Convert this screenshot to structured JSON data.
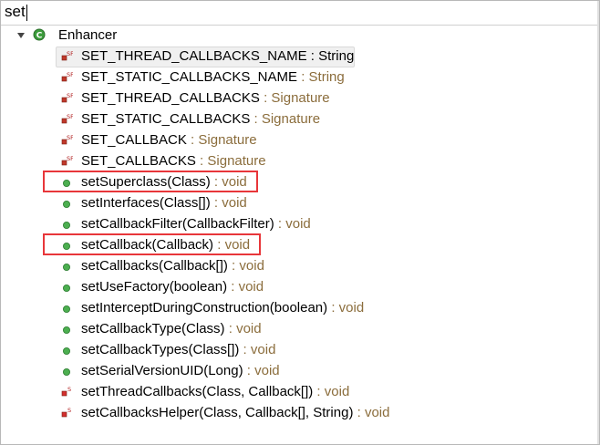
{
  "filter": {
    "value": "set"
  },
  "root": {
    "label": "Enhancer",
    "icon": "class-public-icon"
  },
  "members": [
    {
      "name": "SET_THREAD_CALLBACKS_NAME",
      "type": " : String",
      "kind": "static-final-field",
      "selected": true
    },
    {
      "name": "SET_STATIC_CALLBACKS_NAME",
      "type": " : String",
      "kind": "static-final-field"
    },
    {
      "name": "SET_THREAD_CALLBACKS",
      "type": " : Signature",
      "kind": "static-final-field"
    },
    {
      "name": "SET_STATIC_CALLBACKS",
      "type": " : Signature",
      "kind": "static-final-field"
    },
    {
      "name": "SET_CALLBACK",
      "type": " : Signature",
      "kind": "static-final-field"
    },
    {
      "name": "SET_CALLBACKS",
      "type": " : Signature",
      "kind": "static-final-field"
    },
    {
      "name": "setSuperclass(Class)",
      "type": " : void",
      "kind": "public-method",
      "outlined": true
    },
    {
      "name": "setInterfaces(Class[])",
      "type": " : void",
      "kind": "public-method"
    },
    {
      "name": "setCallbackFilter(CallbackFilter)",
      "type": " : void",
      "kind": "public-method"
    },
    {
      "name": "setCallback(Callback)",
      "type": " : void",
      "kind": "public-method",
      "outlined": true
    },
    {
      "name": "setCallbacks(Callback[])",
      "type": " : void",
      "kind": "public-method"
    },
    {
      "name": "setUseFactory(boolean)",
      "type": " : void",
      "kind": "public-method"
    },
    {
      "name": "setInterceptDuringConstruction(boolean)",
      "type": " : void",
      "kind": "public-method"
    },
    {
      "name": "setCallbackType(Class)",
      "type": " : void",
      "kind": "public-method"
    },
    {
      "name": "setCallbackTypes(Class[])",
      "type": " : void",
      "kind": "public-method"
    },
    {
      "name": "setSerialVersionUID(Long)",
      "type": " : void",
      "kind": "public-method"
    },
    {
      "name": "setThreadCallbacks(Class, Callback[])",
      "type": " : void",
      "kind": "private-static-method"
    },
    {
      "name": "setCallbacksHelper(Class, Callback[], String)",
      "type": " : void",
      "kind": "private-static-method"
    }
  ],
  "colors": {
    "type_text": "#8b6d3c",
    "outline": "#e8363a",
    "method_green": "#4caf50",
    "field_red": "#c0392b",
    "private_red": "#d32f2f"
  }
}
